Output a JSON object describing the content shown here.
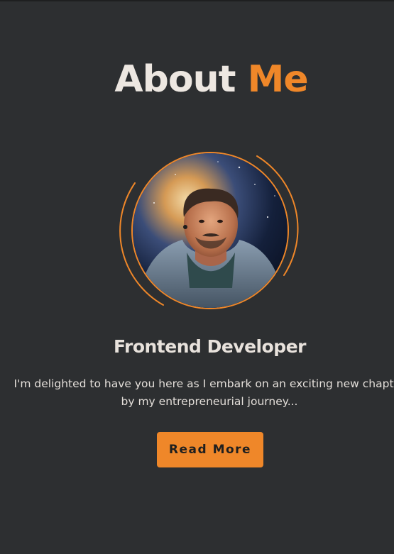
{
  "heading": {
    "word1": "About",
    "word2": "Me"
  },
  "profile": {
    "avatar_icon": "developer-portrait",
    "role": "Frontend Developer",
    "description_line1": "I'm delighted to have you here as I embark on an exciting new chapter",
    "description_line2": "by my entrepreneurial journey..."
  },
  "cta": {
    "label": "Read More"
  },
  "colors": {
    "background": "#2d2f31",
    "accent": "#ef8729",
    "text": "#ede7e1"
  }
}
